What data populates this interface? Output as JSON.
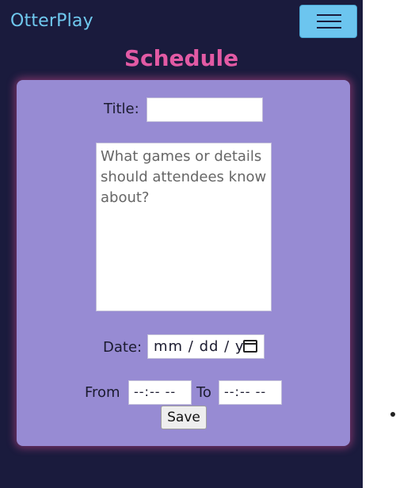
{
  "app": {
    "brand": "OtterPlay"
  },
  "page": {
    "title": "Schedule"
  },
  "form": {
    "title_label": "Title:",
    "title_value": "",
    "details_placeholder": "What games or details should attendees know about?",
    "date_label": "Date:",
    "date_placeholder": "mm / dd / y",
    "from_label": "From",
    "to_label": "To",
    "from_placeholder": "--:-- --",
    "to_placeholder": "--:-- --",
    "save_label": "Save"
  },
  "icons": {
    "menu": "hamburger-menu-icon",
    "calendar": "calendar-icon"
  },
  "colors": {
    "background": "#1a1b3d",
    "card": "#978bd3",
    "brand": "#6fc8ee",
    "accent_title": "#e25aa4",
    "menu_button": "#6cc5ef"
  }
}
